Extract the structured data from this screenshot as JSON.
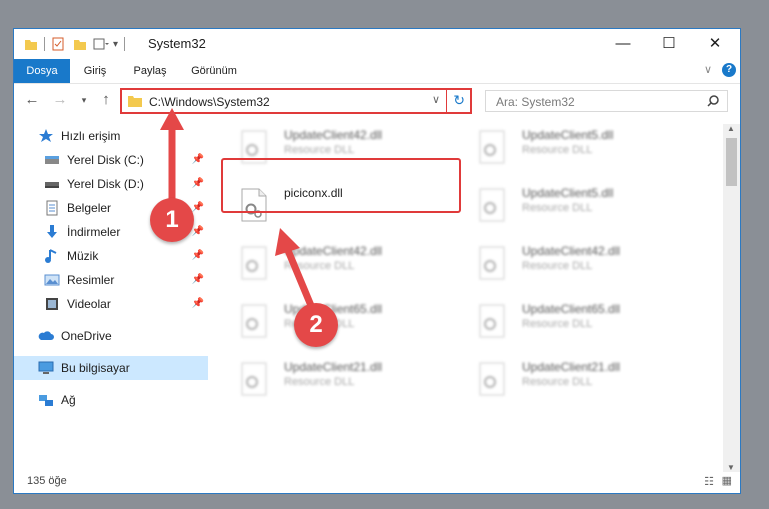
{
  "window": {
    "title": "System32"
  },
  "ribbon": {
    "tabs": [
      "Dosya",
      "Giriş",
      "Paylaş",
      "Görünüm"
    ]
  },
  "address": {
    "path": "C:\\Windows\\System32"
  },
  "search": {
    "placeholder": "Ara: System32"
  },
  "sidebar": {
    "items": [
      {
        "label": "Hızlı erişim",
        "icon": "star-icon"
      },
      {
        "label": "Yerel Disk (C:)",
        "icon": "drive-icon",
        "pinned": true
      },
      {
        "label": "Yerel Disk (D:)",
        "icon": "drive-icon",
        "pinned": true
      },
      {
        "label": "Belgeler",
        "icon": "documents-icon",
        "pinned": true
      },
      {
        "label": "İndirmeler",
        "icon": "download-icon",
        "pinned": true
      },
      {
        "label": "Müzik",
        "icon": "music-icon",
        "pinned": true
      },
      {
        "label": "Resimler",
        "icon": "pictures-icon",
        "pinned": true
      },
      {
        "label": "Videolar",
        "icon": "videos-icon",
        "pinned": true
      },
      {
        "label": "OneDrive",
        "icon": "cloud-icon"
      },
      {
        "label": "Bu bilgisayar",
        "icon": "computer-icon",
        "selected": true
      },
      {
        "label": "Ağ",
        "icon": "network-icon"
      }
    ]
  },
  "files": {
    "left": [
      {
        "name": "UpdateClient42.dll",
        "type": "Resource DLL"
      },
      {
        "name": "piciconx.dll",
        "type": ""
      },
      {
        "name": "UpdateClient42.dll",
        "type": "Resource DLL"
      },
      {
        "name": "UpdateClient65.dll",
        "type": "Resource DLL"
      },
      {
        "name": "UpdateClient21.dll",
        "type": "Resource DLL"
      }
    ],
    "right": [
      {
        "name": "UpdateClient5.dll",
        "type": "Resource DLL"
      },
      {
        "name": "UpdateClient5.dll",
        "type": "Resource DLL"
      },
      {
        "name": "UpdateClient42.dll",
        "type": "Resource DLL"
      },
      {
        "name": "UpdateClient65.dll",
        "type": "Resource DLL"
      },
      {
        "name": "UpdateClient21.dll",
        "type": "Resource DLL"
      }
    ]
  },
  "status": {
    "count": "135 öğe"
  },
  "annotations": {
    "step1": "1",
    "step2": "2"
  },
  "colors": {
    "accent": "#1979ca",
    "highlight": "#e03a3a",
    "selection": "#cce8ff"
  }
}
